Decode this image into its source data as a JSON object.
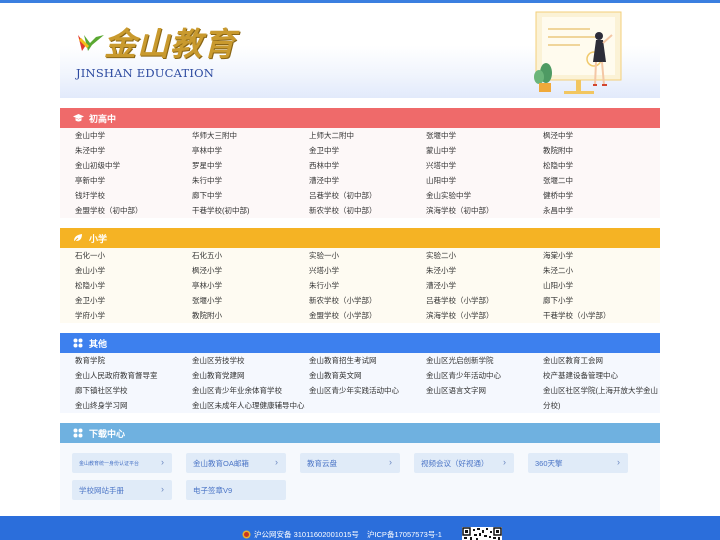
{
  "header": {
    "logo_cn": "金山教育",
    "logo_en": "JINSHAN EDUCATION"
  },
  "sections": [
    {
      "title": "初高中",
      "icon": "graduation-cap-icon",
      "color": "#ef6a6a",
      "items": [
        "金山中学",
        "华师大三附中",
        "上师大二附中",
        "张堰中学",
        "枫泾中学",
        "朱泾中学",
        "亭林中学",
        "金卫中学",
        "蒙山中学",
        "教院附中",
        "金山初级中学",
        "罗星中学",
        "西林中学",
        "兴塔中学",
        "松隐中学",
        "亭新中学",
        "朱行中学",
        "漕泾中学",
        "山阳中学",
        "张堰二中",
        "钱圩学校",
        "廊下中学",
        "吕巷学校（初中部）",
        "金山实验中学",
        "健桥中学",
        "金盟学校（初中部）",
        "干巷学校(初中部)",
        "新农学校（初中部）",
        "滨海学校（初中部）",
        "永昌中学"
      ]
    },
    {
      "title": "小学",
      "icon": "leaf-icon",
      "color": "#f5b324",
      "items": [
        "石化一小",
        "石化五小",
        "实验一小",
        "实验二小",
        "海棠小学",
        "金山小学",
        "枫泾小学",
        "兴塔小学",
        "朱泾小学",
        "朱泾二小",
        "松隐小学",
        "亭林小学",
        "朱行小学",
        "漕泾小学",
        "山阳小学",
        "金卫小学",
        "张堰小学",
        "新农学校（小学部）",
        "吕巷学校（小学部）",
        "廊下小学",
        "学府小学",
        "教院附小",
        "金盟学校（小学部）",
        "滨海学校（小学部）",
        "干巷学校（小学部）"
      ]
    },
    {
      "title": "其他",
      "icon": "grid-icon",
      "color": "#3d80ee",
      "items": [
        "教育学院",
        "金山区劳技学校",
        "金山教育招生考试网",
        "金山区光启创新学院",
        "金山区教育工会网",
        "金山人民政府教育督导室",
        "金山教育党建网",
        "金山教育英文网",
        "金山区青少年活动中心",
        "校产基建设备管理中心",
        "廊下镇社区学校",
        "金山区青少年业余体育学校",
        "金山区青少年实践活动中心",
        "金山区语言文字网",
        "金山区社区学院(上海开放大学金山分校)",
        "金山终身学习网",
        "金山区未成年人心理健康辅导中心"
      ]
    }
  ],
  "download": {
    "title": "下载中心",
    "icon": "grid-icon",
    "color": "#6fb1e0",
    "items": [
      "金山教育统一身份认证平台",
      "金山教育OA邮箱",
      "教育云盘",
      "视频会议（好视通）",
      "360天擎",
      "学校网站手册",
      "电子签章V9"
    ],
    "arrow": "›"
  },
  "footer": {
    "police": "沪公网安备 31011602001015号",
    "icp": "沪ICP备17057573号-1"
  }
}
